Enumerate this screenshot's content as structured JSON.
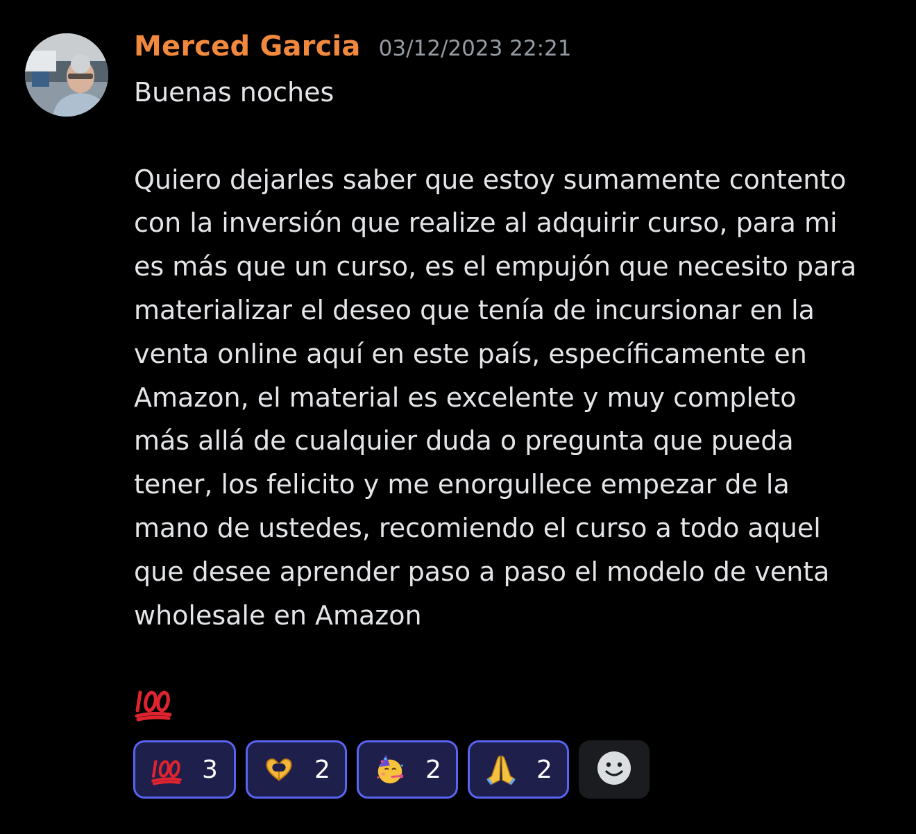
{
  "message": {
    "author": "Merced Garcia",
    "timestamp": "03/12/2023 22:21",
    "author_color": "#f0883e",
    "avatar_icon": "user-avatar-photo",
    "lines": [
      "Buenas noches",
      "",
      "Quiero dejarles saber que estoy sumamente contento",
      "con la inversión que realize al adquirir curso, para mi",
      "es más que un curso, es el empujón que necesito para",
      "materializar el deseo que tenía de incursionar en la",
      "venta online aquí en este país, específicamente en",
      "Amazon, el material es excelente y muy completo",
      "más allá de cualquier duda o pregunta que pueda",
      "tener, los felicito y me enorgullece empezar de la",
      "mano de ustedes, recomiendo el curso a todo aquel",
      "que desee aprender paso a paso el modelo de venta",
      "wholesale en Amazon"
    ],
    "trailing_emoji": "hundred-points-icon"
  },
  "reactions": [
    {
      "emoji": "hundred-points-icon",
      "count": "3"
    },
    {
      "emoji": "heart-hands-icon",
      "count": "2"
    },
    {
      "emoji": "partying-face-icon",
      "count": "2"
    },
    {
      "emoji": "folded-hands-icon",
      "count": "2"
    }
  ],
  "add_reaction_icon": "smiley-add-reaction-icon",
  "colors": {
    "background": "#000000",
    "reaction_border": "#5865f2",
    "reaction_bg": "#1e1f4a",
    "timestamp": "#959ba3"
  }
}
